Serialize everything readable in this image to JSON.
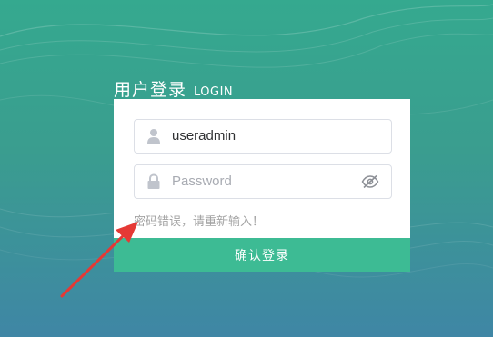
{
  "title": {
    "cn": "用户登录",
    "en": "LOGIN"
  },
  "form": {
    "username_value": "useradmin",
    "password_placeholder": "Password",
    "error_message": "密码错误，请重新输入！",
    "submit_label": "确认登录"
  },
  "icons": {
    "username": "user-icon",
    "password": "lock-icon",
    "toggle_visibility": "eye-off-icon"
  },
  "colors": {
    "button": "#3dbb94",
    "annotation_arrow": "#e53935"
  }
}
